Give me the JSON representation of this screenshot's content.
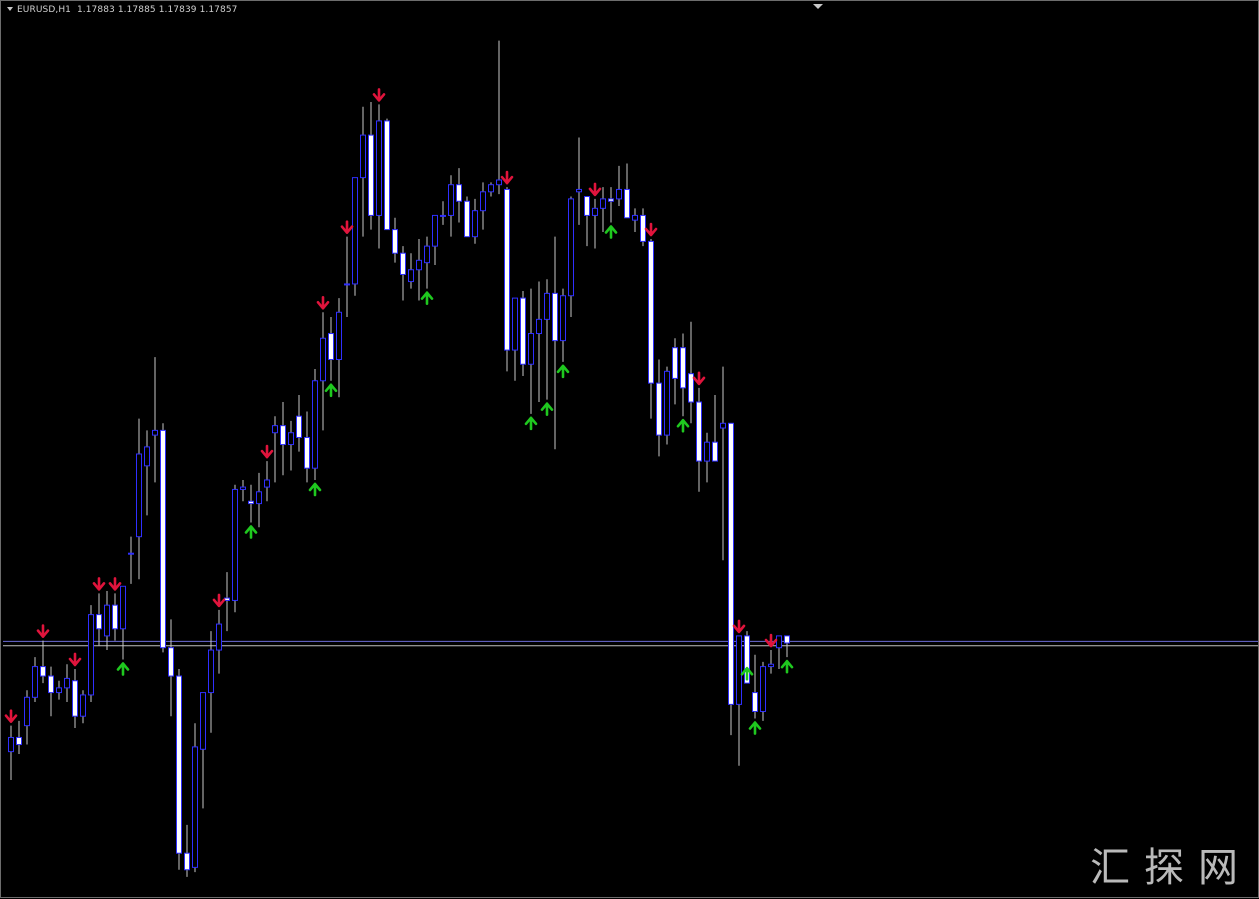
{
  "window": {
    "symbol_title": "EURUSD,H1",
    "ohlc_text": "1.17883 1.17885 1.17839 1.17857",
    "watermark": "汇探网"
  },
  "colors": {
    "background": "#000000",
    "candle_body": "#2f2fff",
    "candle_fill_bull": "#000000",
    "candle_fill_bear": "#ffffff",
    "wick": "#c8c8c8",
    "bid_line": "#6b6bd6",
    "ask_line": "#c0c0c0",
    "arrow_up": "#1fc81f",
    "arrow_down": "#e0143c"
  },
  "chart_data": {
    "type": "candlestick",
    "symbol": "EURUSD",
    "timeframe": "H1",
    "last_ohlc": {
      "open": 1.17883,
      "high": 1.17885,
      "low": 1.17839,
      "close": 1.17857
    },
    "price_lines": {
      "bid": 1.17857,
      "ask": 1.17838
    },
    "candles": [
      [
        1.1739,
        1.175,
        1.1727,
        1.1745
      ],
      [
        1.1745,
        1.1752,
        1.1738,
        1.1742
      ],
      [
        1.175,
        1.1765,
        1.1742,
        1.1762
      ],
      [
        1.1762,
        1.1779,
        1.176,
        1.1775
      ],
      [
        1.1775,
        1.1786,
        1.1768,
        1.1771
      ],
      [
        1.1771,
        1.1775,
        1.1754,
        1.1764
      ],
      [
        1.1764,
        1.1769,
        1.1761,
        1.1766
      ],
      [
        1.1766,
        1.1776,
        1.176,
        1.177
      ],
      [
        1.1769,
        1.1774,
        1.1749,
        1.1754
      ],
      [
        1.1754,
        1.1765,
        1.1751,
        1.1763
      ],
      [
        1.1763,
        1.1801,
        1.176,
        1.1797
      ],
      [
        1.1797,
        1.1806,
        1.1784,
        1.1791
      ],
      [
        1.1788,
        1.1807,
        1.1782,
        1.1801
      ],
      [
        1.1801,
        1.1806,
        1.1786,
        1.1791
      ],
      [
        1.1791,
        1.1809,
        1.1778,
        1.1809
      ],
      [
        1.1823,
        1.183,
        1.181,
        1.1823
      ],
      [
        1.183,
        1.188,
        1.1812,
        1.1865
      ],
      [
        1.186,
        1.1875,
        1.1839,
        1.1868
      ],
      [
        1.1873,
        1.1906,
        1.1853,
        1.1875
      ],
      [
        1.1875,
        1.1878,
        1.1781,
        1.1783
      ],
      [
        1.1783,
        1.1795,
        1.1754,
        1.1771
      ],
      [
        1.1771,
        1.1774,
        1.1689,
        1.1696
      ],
      [
        1.1696,
        1.1708,
        1.1686,
        1.1689
      ],
      [
        1.169,
        1.1751,
        1.1688,
        1.1741
      ],
      [
        1.174,
        1.1758,
        1.1715,
        1.1764
      ],
      [
        1.1764,
        1.179,
        1.1747,
        1.1782
      ],
      [
        1.1782,
        1.1799,
        1.1772,
        1.1793
      ],
      [
        1.1804,
        1.1815,
        1.179,
        1.1803
      ],
      [
        1.1803,
        1.1852,
        1.1798,
        1.185
      ],
      [
        1.185,
        1.1854,
        1.1845,
        1.1851
      ],
      [
        1.1845,
        1.1852,
        1.1836,
        1.1844
      ],
      [
        1.1844,
        1.1857,
        1.1834,
        1.1849
      ],
      [
        1.1851,
        1.1862,
        1.1845,
        1.1854
      ],
      [
        1.1874,
        1.1881,
        1.1853,
        1.1877
      ],
      [
        1.1877,
        1.1887,
        1.1856,
        1.1869
      ],
      [
        1.1869,
        1.1879,
        1.1858,
        1.1874
      ],
      [
        1.1881,
        1.189,
        1.1866,
        1.1872
      ],
      [
        1.1872,
        1.1883,
        1.1853,
        1.1859
      ],
      [
        1.1859,
        1.1901,
        1.1854,
        1.1896
      ],
      [
        1.1896,
        1.1925,
        1.1875,
        1.1914
      ],
      [
        1.1916,
        1.1923,
        1.1896,
        1.1905
      ],
      [
        1.1905,
        1.1931,
        1.1889,
        1.1925
      ],
      [
        1.1937,
        1.1957,
        1.1923,
        1.1937
      ],
      [
        1.1937,
        1.1982,
        1.1932,
        1.1982
      ],
      [
        1.1982,
        1.2012,
        1.1957,
        1.2
      ],
      [
        1.2,
        1.2014,
        1.196,
        1.1966
      ],
      [
        1.1966,
        1.2013,
        1.1952,
        1.2006
      ],
      [
        1.2006,
        1.2007,
        1.196,
        1.196
      ],
      [
        1.196,
        1.1965,
        1.1946,
        1.195
      ],
      [
        1.195,
        1.1953,
        1.193,
        1.1941
      ],
      [
        1.1938,
        1.195,
        1.1935,
        1.1943
      ],
      [
        1.1943,
        1.1956,
        1.193,
        1.1947
      ],
      [
        1.1946,
        1.1957,
        1.1935,
        1.1953
      ],
      [
        1.1953,
        1.1966,
        1.1945,
        1.1966
      ],
      [
        1.1966,
        1.1972,
        1.1962,
        1.1966
      ],
      [
        1.1966,
        1.1983,
        1.1957,
        1.1979
      ],
      [
        1.1979,
        1.1986,
        1.1963,
        1.1972
      ],
      [
        1.1972,
        1.1974,
        1.1957,
        1.1957
      ],
      [
        1.1957,
        1.1973,
        1.1954,
        1.1968
      ],
      [
        1.1968,
        1.198,
        1.196,
        1.1976
      ],
      [
        1.1976,
        1.198,
        1.1974,
        1.1979
      ],
      [
        1.1979,
        1.204,
        1.1975,
        1.1981
      ],
      [
        1.1977,
        1.1978,
        1.19,
        1.1909
      ],
      [
        1.1909,
        1.1924,
        1.1896,
        1.1931
      ],
      [
        1.1931,
        1.1934,
        1.1898,
        1.1903
      ],
      [
        1.1903,
        1.1935,
        1.1882,
        1.1916
      ],
      [
        1.1916,
        1.1938,
        1.1887,
        1.1922
      ],
      [
        1.1922,
        1.1939,
        1.1888,
        1.1933
      ],
      [
        1.1933,
        1.1957,
        1.1867,
        1.1913
      ],
      [
        1.1913,
        1.1935,
        1.1904,
        1.1932
      ],
      [
        1.1932,
        1.1974,
        1.1923,
        1.1973
      ],
      [
        1.1976,
        1.1999,
        1.1962,
        1.1977
      ],
      [
        1.1974,
        1.1974,
        1.1953,
        1.1966
      ],
      [
        1.1966,
        1.1973,
        1.1952,
        1.1969
      ],
      [
        1.1969,
        1.1978,
        1.1959,
        1.1973
      ],
      [
        1.1973,
        1.1978,
        1.1963,
        1.1972
      ],
      [
        1.1973,
        1.1987,
        1.197,
        1.1977
      ],
      [
        1.1977,
        1.1988,
        1.1973,
        1.1965
      ],
      [
        1.1964,
        1.1969,
        1.1959,
        1.1966
      ],
      [
        1.1966,
        1.1969,
        1.1953,
        1.1955
      ],
      [
        1.1955,
        1.1956,
        1.188,
        1.1895
      ],
      [
        1.1895,
        1.1905,
        1.1864,
        1.1873
      ],
      [
        1.1873,
        1.1902,
        1.1869,
        1.19
      ],
      [
        1.191,
        1.1914,
        1.1886,
        1.1897
      ],
      [
        1.191,
        1.1916,
        1.1881,
        1.1893
      ],
      [
        1.1899,
        1.1921,
        1.1878,
        1.1887
      ],
      [
        1.1887,
        1.1893,
        1.1849,
        1.1862
      ],
      [
        1.1862,
        1.1874,
        1.1853,
        1.187
      ],
      [
        1.187,
        1.189,
        1.1862,
        1.1862
      ],
      [
        1.1876,
        1.1902,
        1.182,
        1.1878
      ],
      [
        1.1878,
        1.1878,
        1.1746,
        1.1759
      ],
      [
        1.1759,
        1.1788,
        1.1733,
        1.1788
      ],
      [
        1.1788,
        1.179,
        1.1776,
        1.1768
      ],
      [
        1.1764,
        1.178,
        1.1753,
        1.1756
      ],
      [
        1.1756,
        1.1777,
        1.1752,
        1.1775
      ],
      [
        1.1775,
        1.1782,
        1.1772,
        1.1776
      ],
      [
        1.1783,
        1.1788,
        1.1774,
        1.1788
      ],
      [
        1.1788,
        1.1788,
        1.1779,
        1.1785
      ]
    ],
    "signals": [
      {
        "i": 0,
        "dir": "down"
      },
      {
        "i": 4,
        "dir": "down"
      },
      {
        "i": 8,
        "dir": "down"
      },
      {
        "i": 11,
        "dir": "down"
      },
      {
        "i": 13,
        "dir": "down"
      },
      {
        "i": 14,
        "dir": "up"
      },
      {
        "i": 26,
        "dir": "down"
      },
      {
        "i": 30,
        "dir": "up"
      },
      {
        "i": 32,
        "dir": "down"
      },
      {
        "i": 38,
        "dir": "up"
      },
      {
        "i": 39,
        "dir": "down"
      },
      {
        "i": 40,
        "dir": "up"
      },
      {
        "i": 42,
        "dir": "down"
      },
      {
        "i": 46,
        "dir": "down"
      },
      {
        "i": 52,
        "dir": "up"
      },
      {
        "i": 62,
        "dir": "down"
      },
      {
        "i": 65,
        "dir": "up"
      },
      {
        "i": 67,
        "dir": "up"
      },
      {
        "i": 69,
        "dir": "up"
      },
      {
        "i": 73,
        "dir": "down"
      },
      {
        "i": 75,
        "dir": "up"
      },
      {
        "i": 80,
        "dir": "down"
      },
      {
        "i": 84,
        "dir": "up"
      },
      {
        "i": 86,
        "dir": "down"
      },
      {
        "i": 91,
        "dir": "down"
      },
      {
        "i": 92,
        "dir": "up"
      },
      {
        "i": 93,
        "dir": "up"
      },
      {
        "i": 95,
        "dir": "down"
      },
      {
        "i": 97,
        "dir": "up"
      },
      {
        "i": 98,
        "dir": "down"
      }
    ],
    "ylim": [
      1.168,
      1.205
    ],
    "grid": false
  }
}
